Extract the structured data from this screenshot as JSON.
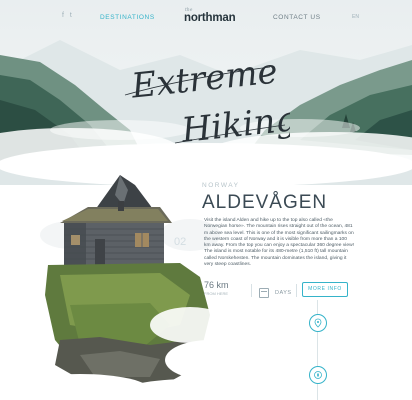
{
  "nav": {
    "social": "f  t",
    "destinations": "DESTINATIONS",
    "contact": "CONTACT US",
    "lang": "EN"
  },
  "logo": {
    "small": "the",
    "main": "northman"
  },
  "hero": {
    "title_line1": "Extreme",
    "title_line2": "Hiking"
  },
  "article": {
    "country": "NORWAY",
    "place": "ALDEVÅGEN",
    "index": "02",
    "paragraph1": "Visit the island Alden and hike up to the top also called «the Norwegian horse». The mountain rises straight out of the ocean, 481 m above sea level. This is one of the most significant sailingmarks on the western coast of Norway and it is visible from more than a 100 km away. From the top you can enjoy a spectacular 360 degree view!",
    "paragraph2": "The island is most notable for its 480-metre (1,510 ft) tall mountain called Norskehesten. The mountain dominates the island, giving it very steep coastlines."
  },
  "stats": {
    "distance_value": "76 km",
    "distance_unit": "FROM HERE",
    "days_label": "DAYS",
    "more_label": "MORE INFO"
  },
  "icons": [
    "logo-icon",
    "map-pin-icon",
    "compass-icon"
  ],
  "colors": {
    "accent": "#35b3c9",
    "dark": "#26343c",
    "text": "#4d5c65"
  }
}
